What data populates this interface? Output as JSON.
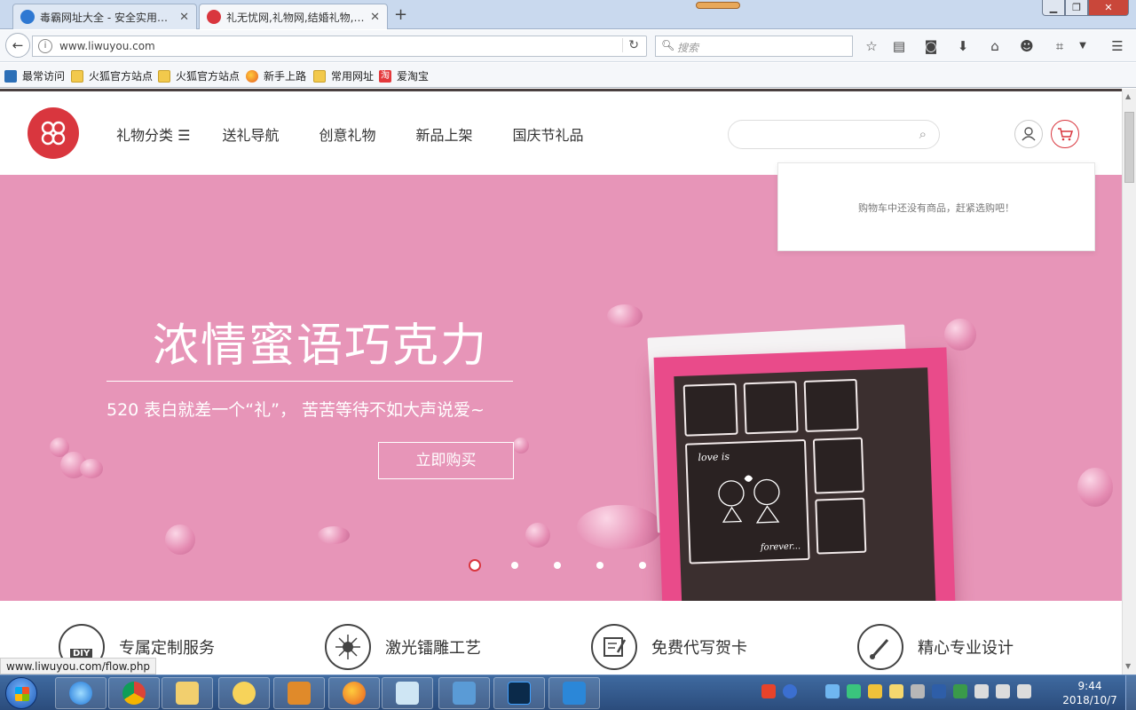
{
  "browser": {
    "tabs": [
      {
        "title": "毒霸网址大全 - 安全实用…",
        "close": "✕"
      },
      {
        "title": "礼无忧网,礼物网,结婚礼物,…",
        "close": "✕"
      }
    ],
    "new_tab": "+",
    "url": "www.liwuyou.com",
    "search_placeholder": "搜索",
    "bookmarks": [
      "最常访问",
      "火狐官方站点",
      "火狐官方站点",
      "新手上路",
      "常用网址",
      "爱淘宝"
    ],
    "taobao_glyph": "淘",
    "status_url": "www.liwuyou.com/flow.php"
  },
  "site": {
    "nav": [
      "礼物分类 ☰",
      "送礼导航",
      "创意礼物",
      "新品上架",
      "国庆节礼品"
    ],
    "cart_empty": "购物车中还没有商品，赶紧选购吧！",
    "banner": {
      "title": "浓情蜜语巧克力",
      "subtitle": "520 表白就差一个“礼”， 苦苦等待不如大声说爱~",
      "button": "立即购买",
      "slide_active": 1,
      "slide_count": 5,
      "choc_text": [
        "love is",
        "forever..."
      ]
    },
    "features": [
      "专属定制服务",
      "激光镭雕工艺",
      "免费代写贺卡",
      "精心专业设计"
    ],
    "diy_label": "DIY"
  },
  "taskbar": {
    "time": "9:44",
    "date": "2018/10/7"
  },
  "colors": {
    "brand_red": "#d9363e",
    "banner_pink": "#e795b8",
    "box_pink": "#e94b8a"
  }
}
